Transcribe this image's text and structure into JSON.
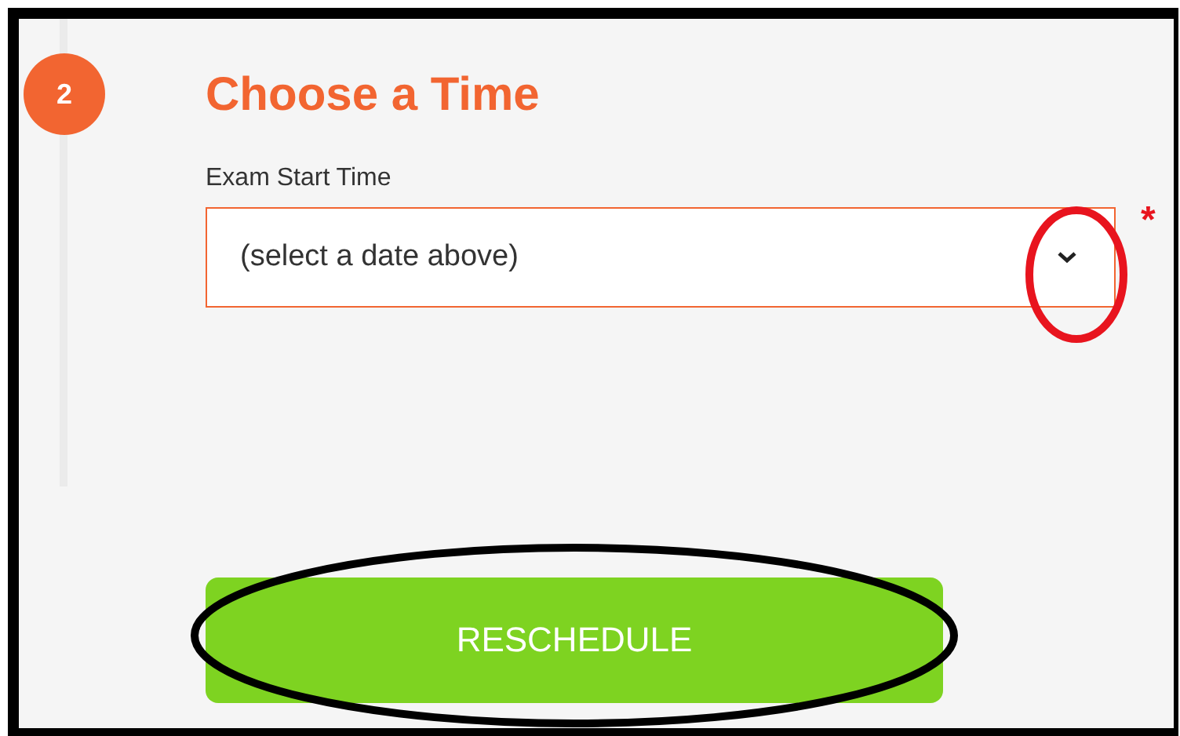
{
  "step": {
    "number": "2",
    "title": "Choose a Time"
  },
  "field": {
    "label": "Exam Start Time",
    "value": "(select a date above)",
    "required_mark": "*"
  },
  "button": {
    "label": "RESCHEDULE"
  },
  "annotations": [
    {
      "color": "#e8141e"
    },
    {
      "color": "#000000"
    }
  ]
}
